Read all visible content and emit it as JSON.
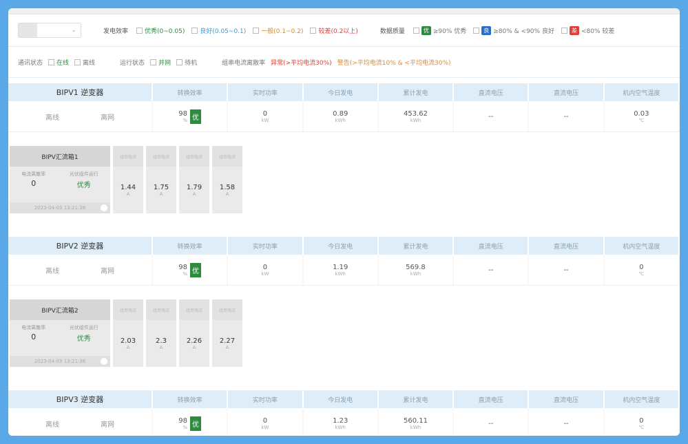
{
  "filters": {
    "select_placeholder": "",
    "select_arrow": "⌄",
    "group1_label": "发电效率",
    "group1_options": [
      {
        "label": "优秀(0~0.05)",
        "color": "#2e8b3d"
      },
      {
        "label": "良好(0.05~0.1)",
        "color": "#3a9ad9"
      },
      {
        "label": "一般(0.1~0.2)",
        "color": "#e08a2a"
      },
      {
        "label": "较差(0.2以上)",
        "color": "#d9413a"
      }
    ],
    "group2_label": "数据质量",
    "group2_options": [
      {
        "tag": "优",
        "tag_color": "#2e8b3d",
        "label": "≥90% 优秀"
      },
      {
        "tag": "良",
        "tag_color": "#2a6fc9",
        "label": "≥80% & <90% 良好"
      },
      {
        "tag": "差",
        "tag_color": "#d9413a",
        "label": "<80% 较差"
      }
    ],
    "row2": [
      {
        "label": "通讯状态",
        "opts": [
          "在线",
          "离线"
        ],
        "color": "#2e8b3d"
      },
      {
        "label": "运行状态",
        "opts": [
          "并网",
          "待机"
        ],
        "color": "#2e8b3d"
      }
    ],
    "row2_extra_label": "组串电流离散率",
    "row2_extra": [
      {
        "label": "异常(>平均电流30%)",
        "color": "#d9413a"
      },
      {
        "label": "警告(>平均电流10% & <平均电流30%)",
        "color": "#e08a2a"
      }
    ]
  },
  "columns": [
    "转换效率",
    "实时功率",
    "今日发电",
    "累计发电",
    "直流电压",
    "直流电压",
    "机内空气温度"
  ],
  "inverters": [
    {
      "name": "BIPV1 逆变器",
      "status1": "离线",
      "status2": "离网",
      "efficiency": "98",
      "eff_unit": "%",
      "badge": "优",
      "power": "0",
      "power_unit": "kW",
      "today": "0.89",
      "today_unit": "kWh",
      "total": "453.62",
      "total_unit": "kWh",
      "dcv1": "--",
      "dcv2": "--",
      "temp": "0.03",
      "temp_unit": "℃",
      "mppt": {
        "title": "BIPV汇流箱1",
        "stat1_label": "电流离散率",
        "stat1_value": "0",
        "stat2_label": "光伏组件运行",
        "stat2_value": "优秀",
        "time": "2023-04-03 13:21:36",
        "cur_label": "组串电流",
        "currents": [
          {
            "value": "1.44",
            "unit": "A"
          },
          {
            "value": "1.75",
            "unit": "A"
          },
          {
            "value": "1.79",
            "unit": "A"
          },
          {
            "value": "1.58",
            "unit": "A"
          }
        ]
      }
    },
    {
      "name": "BIPV2 逆变器",
      "status1": "离线",
      "status2": "离网",
      "efficiency": "98",
      "eff_unit": "%",
      "badge": "优",
      "power": "0",
      "power_unit": "kW",
      "today": "1.19",
      "today_unit": "kWh",
      "total": "569.8",
      "total_unit": "kWh",
      "dcv1": "--",
      "dcv2": "--",
      "temp": "0",
      "temp_unit": "℃",
      "mppt": {
        "title": "BIPV汇流箱2",
        "stat1_label": "电流离散率",
        "stat1_value": "0",
        "stat2_label": "光伏组件运行",
        "stat2_value": "优秀",
        "time": "2023-04-03 13:21:36",
        "cur_label": "组串电流",
        "currents": [
          {
            "value": "2.03",
            "unit": "A"
          },
          {
            "value": "2.3",
            "unit": "A"
          },
          {
            "value": "2.26",
            "unit": "A"
          },
          {
            "value": "2.27",
            "unit": "A"
          }
        ]
      }
    },
    {
      "name": "BIPV3 逆变器",
      "status1": "离线",
      "status2": "离网",
      "efficiency": "98",
      "eff_unit": "%",
      "badge": "优",
      "power": "0",
      "power_unit": "kW",
      "today": "1.23",
      "today_unit": "kWh",
      "total": "560.11",
      "total_unit": "kWh",
      "dcv1": "--",
      "dcv2": "--",
      "temp": "0",
      "temp_unit": "℃"
    }
  ]
}
